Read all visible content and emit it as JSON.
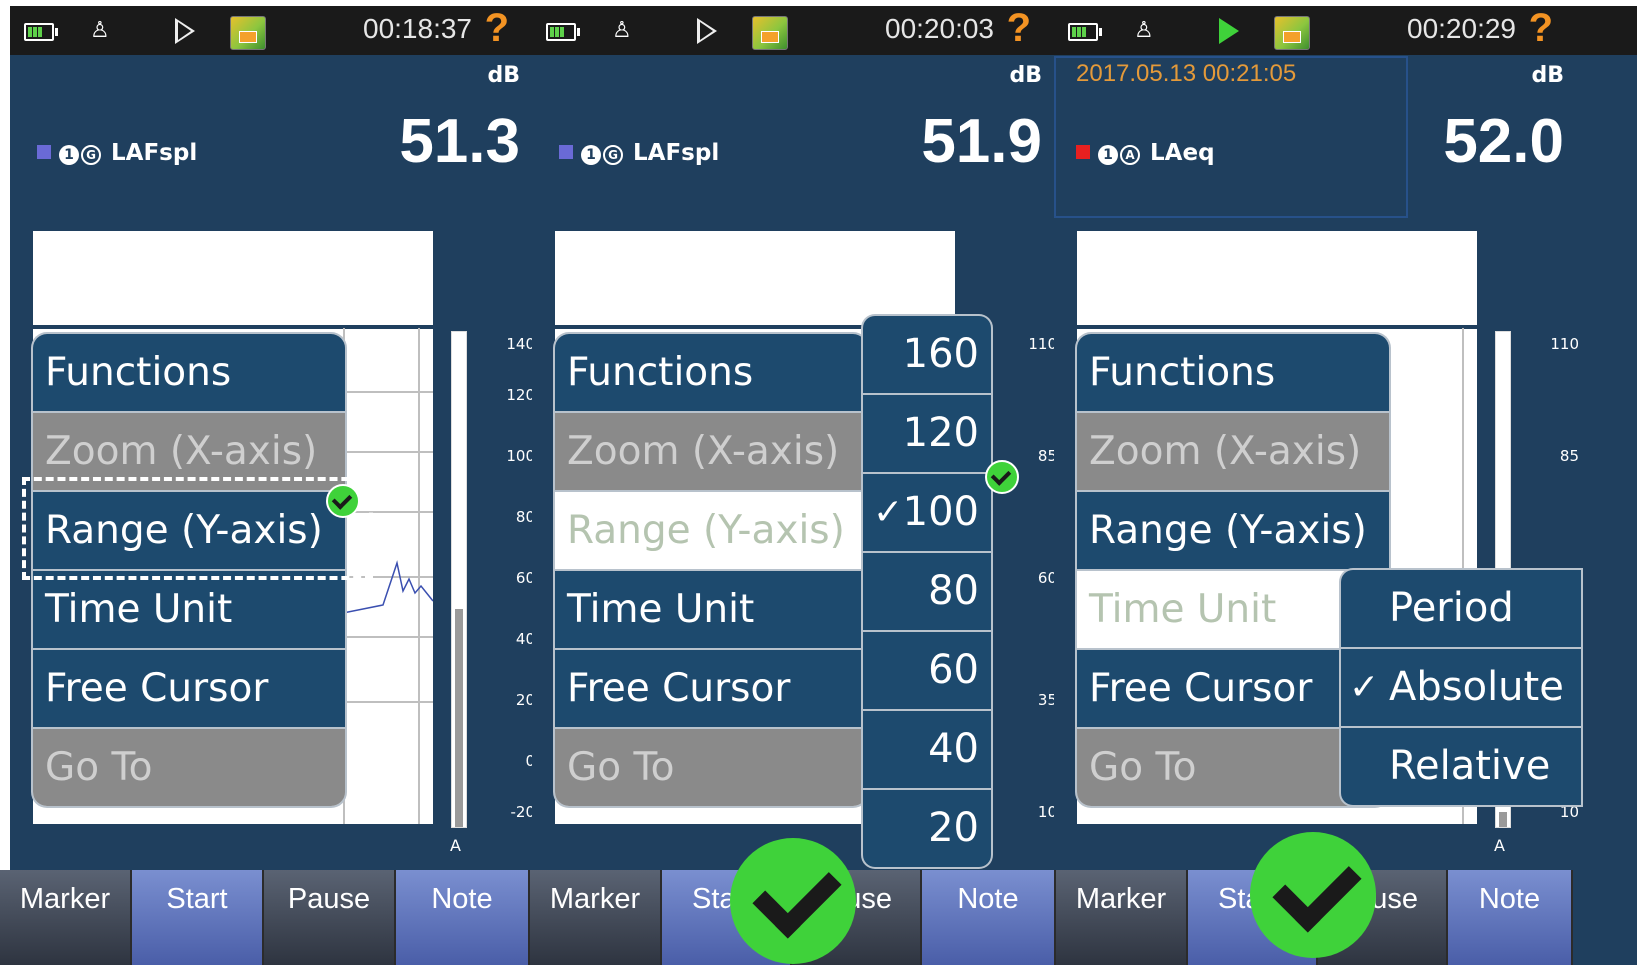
{
  "panels": [
    {
      "status": {
        "time": "00:18:37",
        "help": "?"
      },
      "unit": "dB",
      "measure": {
        "label": "LAFspl",
        "badge1": "1",
        "badge2": "G"
      },
      "value": "51.3",
      "scale": {
        "ticks": [
          "140",
          "120",
          "100",
          "80",
          "60",
          "40",
          "20",
          "0",
          "-20"
        ],
        "meter_label": "A"
      },
      "menu": [
        "Functions",
        "Zoom (X-axis)",
        "Range (Y-axis)",
        "Time Unit",
        "Free Cursor",
        "Go To"
      ]
    },
    {
      "status": {
        "time": "00:20:03",
        "help": "?"
      },
      "unit": "dB",
      "measure": {
        "label": "LAFspl",
        "badge1": "1",
        "badge2": "G"
      },
      "value": "51.9",
      "scale": {
        "ticks": [
          "110",
          "85",
          "60",
          "35",
          "10"
        ]
      },
      "menu": [
        "Functions",
        "Zoom (X-axis)",
        "Range (Y-axis)",
        "Time Unit",
        "Free Cursor",
        "Go To"
      ],
      "range_options": [
        "160",
        "120",
        "100",
        "80",
        "60",
        "40",
        "20"
      ],
      "range_selected": "100"
    },
    {
      "status": {
        "time": "00:20:29",
        "help": "?"
      },
      "unit": "dB",
      "datetime": "2017.05.13 00:21:05",
      "measure": {
        "label": "LAeq",
        "badge1": "1",
        "badge2": "A"
      },
      "value": "52.0",
      "scale": {
        "ticks": [
          "110",
          "85",
          "10"
        ],
        "meter_label": "A"
      },
      "menu": [
        "Functions",
        "Zoom (X-axis)",
        "Range (Y-axis)",
        "Time Unit",
        "Free Cursor",
        "Go To"
      ],
      "time_unit_options": [
        "Period",
        "Absolute",
        "Relative"
      ],
      "time_unit_selected": "Absolute"
    }
  ],
  "softkeys": [
    "Marker",
    "Start",
    "Pause",
    "Note",
    "Marker",
    "Sta",
    "use",
    "Note",
    "Marker",
    "Sta",
    "use",
    "Note"
  ],
  "check_glyph": "✓",
  "colors": {
    "background": "#1f3f5e",
    "menu": "#1d4a6e",
    "disabled": "#8a8a8a",
    "accent": "#3fd23a",
    "help": "#f39323",
    "date": "#e49a3a"
  }
}
